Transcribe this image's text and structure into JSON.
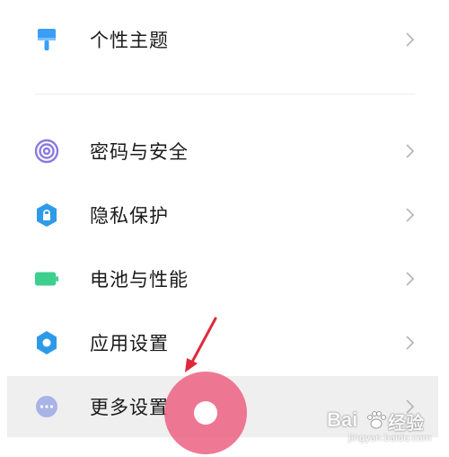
{
  "menu": {
    "top_item": {
      "label": "个性主题",
      "icon": "paint-brush-icon",
      "color": "#3a9ef5"
    },
    "items": [
      {
        "label": "密码与安全",
        "icon": "fingerprint-icon",
        "color": "#8a7ae0"
      },
      {
        "label": "隐私保护",
        "icon": "privacy-shield-icon",
        "color": "#2f9be8"
      },
      {
        "label": "电池与性能",
        "icon": "battery-icon",
        "color": "#3ecf8e"
      },
      {
        "label": "应用设置",
        "icon": "gear-icon",
        "color": "#2d9ae8"
      },
      {
        "label": "更多设置",
        "icon": "more-dots-icon",
        "color": "#a8b4e6"
      }
    ]
  },
  "overlay": {
    "tap_color": "#ec6082",
    "arrow_color": "#e0283c"
  },
  "watermark": {
    "brand": "Bai",
    "brand_tail": "经验",
    "sub": "jingyan.baidu.com"
  }
}
